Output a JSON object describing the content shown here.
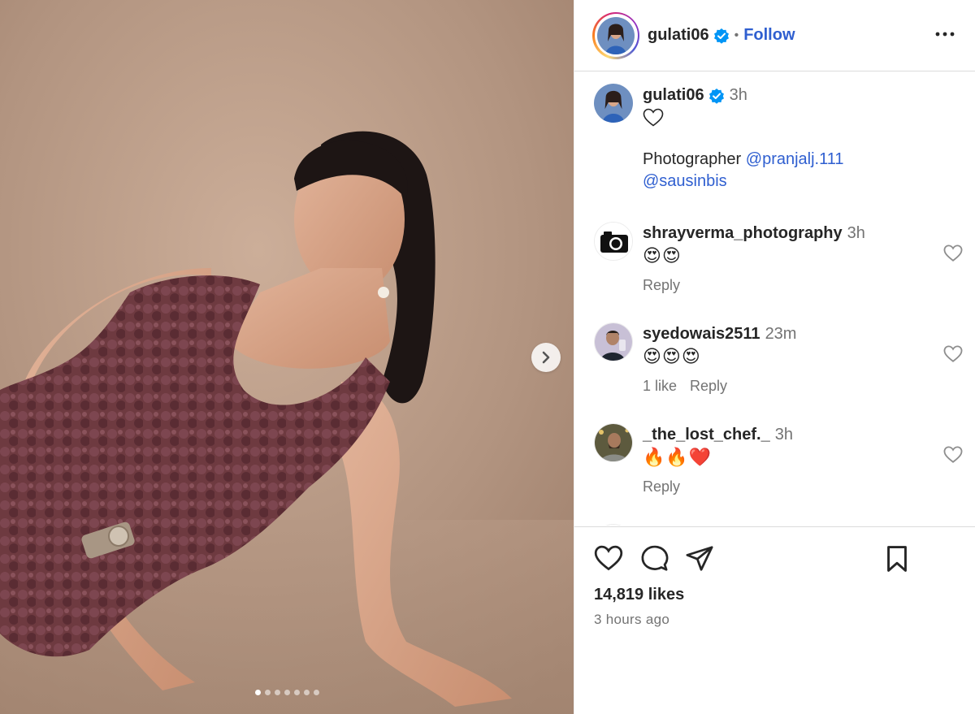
{
  "post": {
    "username": "gulati06",
    "separator": "•",
    "follow_label": "Follow",
    "more_icon": "more-horizontal-icon",
    "carousel": {
      "total_slides": 7,
      "active_slide": 1
    }
  },
  "caption": {
    "username": "gulati06",
    "time": "3h",
    "heart": "♡",
    "text_prefix": "Photographer ",
    "mention_1": "@pranjalj.111",
    "mention_2": "@sausinbis"
  },
  "comments": [
    {
      "username": "shrayverma_photography",
      "time": "3h",
      "text": "😍😍",
      "likes_label": "",
      "reply_label": "Reply",
      "avatar_icon": "camera-icon"
    },
    {
      "username": "syedowais2511",
      "time": "23m",
      "text": "😍😍😍",
      "likes_label": "1 like",
      "reply_label": "Reply",
      "avatar_icon": "user-photo"
    },
    {
      "username": "_the_lost_chef._",
      "time": "3h",
      "text": "🔥🔥❤️",
      "likes_label": "",
      "reply_label": "Reply",
      "avatar_icon": "user-photo"
    }
  ],
  "footer": {
    "likes": "14,819 likes",
    "posted": "3 hours ago"
  },
  "colors": {
    "accent": "#2f5fd0",
    "verified": "#0095f6",
    "muted": "#737373"
  }
}
